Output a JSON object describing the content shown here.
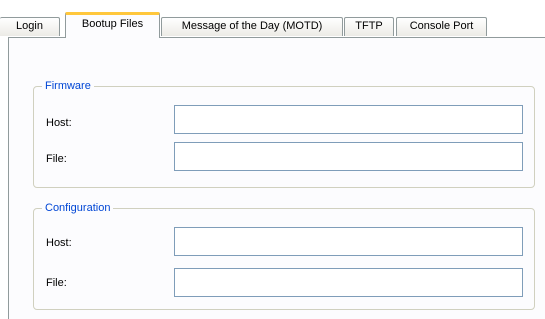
{
  "tabs": [
    {
      "label": "Login",
      "active": false
    },
    {
      "label": "Bootup Files",
      "active": true
    },
    {
      "label": "Message of the Day (MOTD)",
      "active": false
    },
    {
      "label": "TFTP",
      "active": false
    },
    {
      "label": "Console Port",
      "active": false
    }
  ],
  "firmware": {
    "legend": "Firmware",
    "host_label": "Host:",
    "host_value": "",
    "file_label": "File:",
    "file_value": ""
  },
  "configuration": {
    "legend": "Configuration",
    "host_label": "Host:",
    "host_value": "",
    "file_label": "File:",
    "file_value": ""
  },
  "colors": {
    "active_tab_accent": "#ffc73c",
    "legend_text": "#0046d5",
    "panel_bg": "#fcfcfe",
    "border": "#919b9c"
  }
}
